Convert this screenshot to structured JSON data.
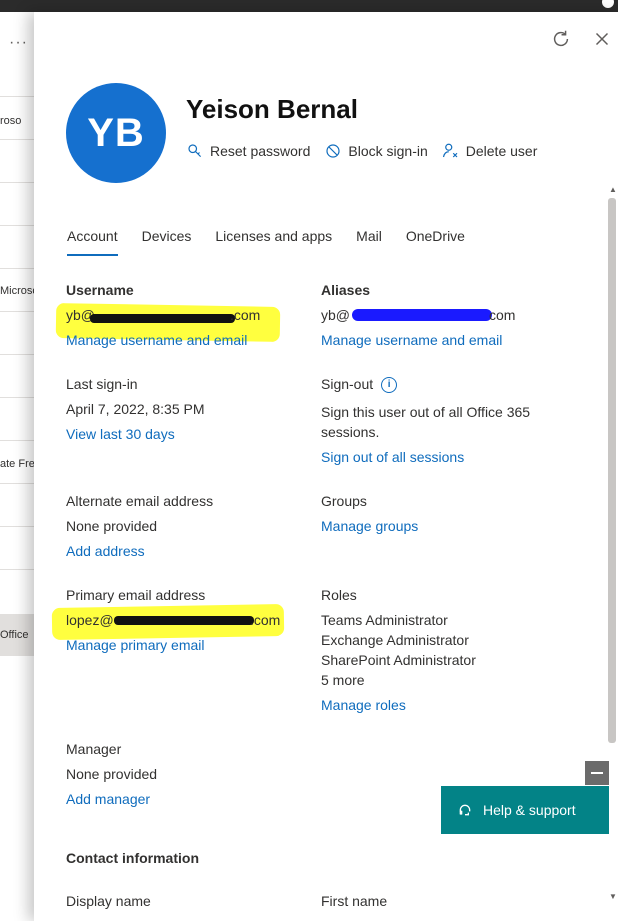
{
  "background_page": {
    "more_glyph": "···",
    "row_texts": [
      "icroso",
      "Microso",
      "ate Fre",
      "Office"
    ]
  },
  "panel": {
    "refresh_icon": "refresh-icon",
    "close_icon": "close-icon",
    "avatar_initials": "YB",
    "user_name": "Yeison Bernal",
    "actions": {
      "reset_password": "Reset password",
      "block_signin": "Block sign-in",
      "delete_user": "Delete user"
    },
    "tabs": [
      "Account",
      "Devices",
      "Licenses and apps",
      "Mail",
      "OneDrive"
    ],
    "active_tab": "Account",
    "username": {
      "label": "Username",
      "value_prefix": "yb@",
      "value_suffix": ".com",
      "link": "Manage username and email"
    },
    "aliases": {
      "label": "Aliases",
      "value_prefix": "yb@",
      "value_suffix": "com",
      "link": "Manage username and email"
    },
    "last_signin": {
      "label": "Last sign-in",
      "value": "April 7, 2022, 8:35 PM",
      "link": "View last 30 days"
    },
    "signout": {
      "label": "Sign-out",
      "info_glyph": "i",
      "text_line1": "Sign this user out of all Office 365",
      "text_line2": "sessions.",
      "link": "Sign out of all sessions"
    },
    "alternate_email": {
      "label": "Alternate email address",
      "value": "None provided",
      "link": "Add address"
    },
    "groups": {
      "label": "Groups",
      "link": "Manage groups"
    },
    "primary_email": {
      "label": "Primary email address",
      "value_prefix": "lopez@",
      "value_suffix": ".com",
      "link": "Manage primary email"
    },
    "roles": {
      "label": "Roles",
      "items": [
        "Teams Administrator",
        "Exchange Administrator",
        "SharePoint Administrator",
        "5 more"
      ],
      "link": "Manage roles"
    },
    "manager": {
      "label": "Manager",
      "value": "None provided",
      "link": "Add manager"
    },
    "contact_information_label": "Contact information",
    "display_name_label": "Display name",
    "first_name_label": "First name",
    "help_support": "Help & support"
  },
  "colors": {
    "accent": "#0f6cbd",
    "avatar": "#1570cf",
    "help_button": "#038387",
    "highlight": "#ffff3f",
    "redaction_black": "#111111",
    "redaction_blue": "#1a1aff"
  }
}
